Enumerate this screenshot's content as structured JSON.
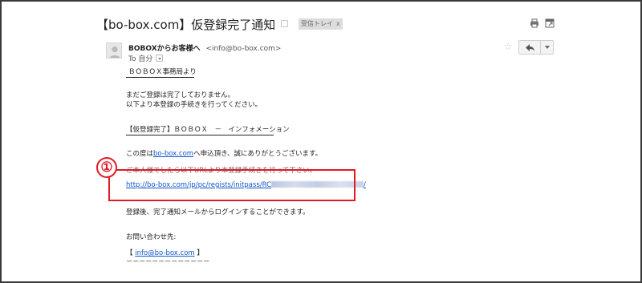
{
  "subject": {
    "title": "【bo-box.com】仮登録完了通知",
    "label": "受信トレイ",
    "label_close": "x"
  },
  "toolbar": {
    "print_icon": "print-icon",
    "newwindow_icon": "new-window-icon"
  },
  "sender": {
    "name": "BOBOXからお客様へ",
    "email": "<info@bo-box.com>",
    "to": "To 自分"
  },
  "actions": {
    "star_icon": "star-icon",
    "reply_icon": "reply-icon",
    "more_icon": "chevron-down-icon"
  },
  "message": {
    "line_office": "ＢＯＢＯＸ事務局より",
    "line_incomplete_1": "まだご登録は完了しておりません。",
    "line_incomplete_2": "以下より本登録の手続きを行ってください。",
    "section_title": "【仮登録完了】ＢＯＢＯＸ　－　インフォメーション",
    "thanks_pre": "この度は",
    "thanks_link": "bo-box.com",
    "thanks_post": "へ申込頂き、誠にありがとうございます。",
    "instruction": "ご本人様でしたら以下URLより本登録手続きを行って下さい。",
    "regist_url": "http://bo-box.com/jp/pc/regists/initpass/RC",
    "regist_url_suffix": "/",
    "after_register": "登録後、完了通知メールからログインすることができます。",
    "contact_label": "お問い合わせ先:",
    "contact_open": "【 ",
    "contact_link": "info@bo-box.com",
    "contact_close": " 】",
    "dashes": "－－－－－－－－－－－－－"
  },
  "annotation": {
    "number": "①",
    "color": "#e01b24"
  },
  "colors": {
    "link": "#1155cc",
    "text": "#222222",
    "frame": "#3a3a3a"
  }
}
